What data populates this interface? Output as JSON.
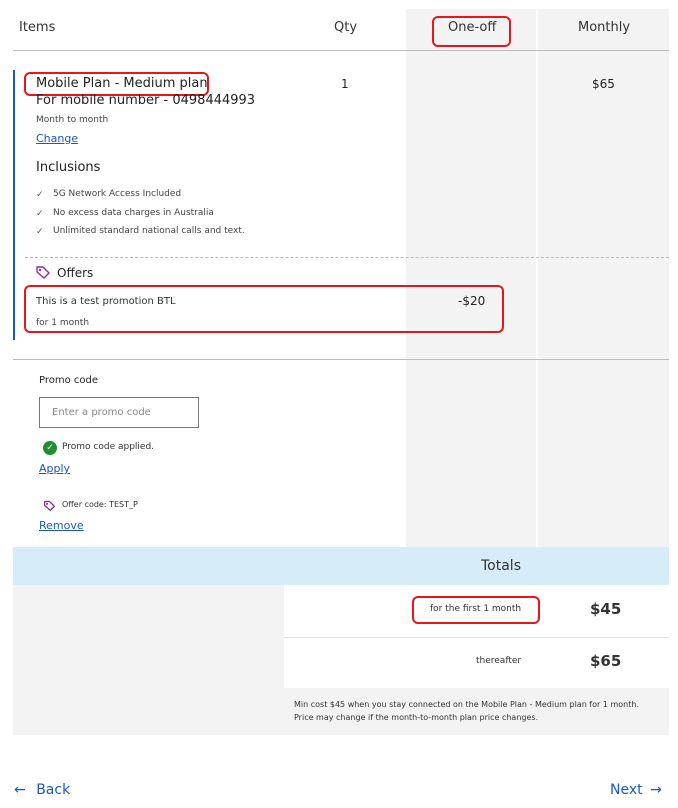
{
  "table_header": {
    "items": "Items",
    "qty": "Qty",
    "one_off": "One-off",
    "monthly": "Monthly"
  },
  "plan": {
    "title": "Mobile Plan - Medium plan",
    "number_line": "For mobile number - 0498444993",
    "term": "Month to month",
    "change_label": "Change",
    "qty": "1",
    "monthly_price": "$65",
    "inclusions_heading": "Inclusions",
    "inclusions": [
      "5G Network Access Included",
      "No excess data charges in Australia",
      "Unlimited standard national calls and text."
    ]
  },
  "offers": {
    "heading": "Offers",
    "promo_name": "This is a test promotion BTL",
    "promo_duration": "for 1 month",
    "one_off_amount": "-$20"
  },
  "promo_code": {
    "label": "Promo code",
    "placeholder": "Enter a promo code",
    "applied_message": "Promo code applied.",
    "apply_label": "Apply",
    "offer_code_text": "Offer code: TEST_P",
    "remove_label": "Remove"
  },
  "totals": {
    "heading": "Totals",
    "rows": [
      {
        "label": "for the first 1 month",
        "amount": "$45"
      },
      {
        "label": "thereafter",
        "amount": "$65"
      }
    ],
    "disclaimer_line1": "Min cost $45 when you stay connected on the Mobile Plan - Medium plan for 1 month.",
    "disclaimer_line2": "Price may change if the month-to-month plan price changes."
  },
  "navigation": {
    "back_label": "Back",
    "next_label": "Next"
  },
  "colors": {
    "link": "#1a56c4",
    "annotation": "#e8161a",
    "totals_header_bg": "#d7ecf9",
    "column_bg": "#f3f3f3",
    "accent_bar": "#1a56c4",
    "success": "#1e8e2e",
    "offer_icon": "#8e2a9b"
  }
}
